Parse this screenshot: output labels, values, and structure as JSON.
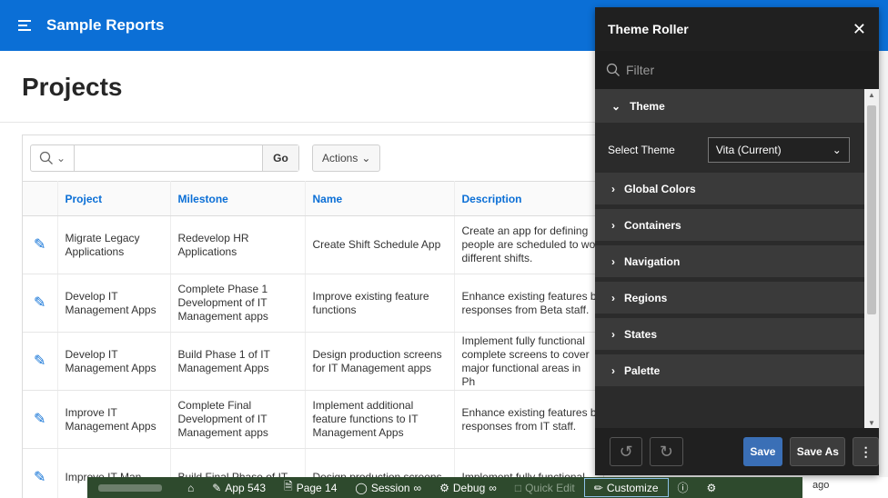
{
  "header": {
    "title": "Sample Reports",
    "menu_icon": "hamburger-icon"
  },
  "page": {
    "title": "Projects"
  },
  "toolbar": {
    "go_label": "Go",
    "actions_label": "Actions"
  },
  "table": {
    "columns": [
      "Project",
      "Milestone",
      "Name",
      "Description"
    ],
    "rows": [
      {
        "project": "Migrate Legacy Applications",
        "milestone": "Redevelop HR Applications",
        "name": "Create Shift Schedule App",
        "description": "Create an app for defining people are scheduled to wo different shifts."
      },
      {
        "project": "Develop IT Management Apps",
        "milestone": "Complete Phase 1 Development of IT Management apps",
        "name": "Improve existing feature functions",
        "description": "Enhance existing features b responses from Beta staff."
      },
      {
        "project": "Develop IT Management Apps",
        "milestone": "Build Phase 1 of IT Management Apps",
        "name": "Design production screens for IT Management apps",
        "description": "Implement fully functional complete screens to cover major functional areas in Ph"
      },
      {
        "project": "Improve IT Management Apps",
        "milestone": "Complete Final Development of IT Management apps",
        "name": "Implement additional feature functions to IT Management Apps",
        "description": "Enhance existing features b responses from IT staff."
      },
      {
        "project": "Improve IT Man",
        "milestone": "Build Final Phase of IT",
        "name": "Design production screens",
        "description": "Implement fully functional"
      }
    ]
  },
  "theme_roller": {
    "title": "Theme Roller",
    "filter_placeholder": "Filter",
    "theme_section": "Theme",
    "select_theme_label": "Select Theme",
    "select_theme_value": "Vita (Current)",
    "sections": [
      "Global Colors",
      "Containers",
      "Navigation",
      "Regions",
      "States",
      "Palette"
    ],
    "save_label": "Save",
    "save_as_label": "Save As"
  },
  "devbar": {
    "app": "App 543",
    "page": "Page 14",
    "session": "Session",
    "debug": "Debug",
    "quick_edit": "Quick Edit",
    "customize": "Customize"
  },
  "misc": {
    "ago": "ago"
  }
}
